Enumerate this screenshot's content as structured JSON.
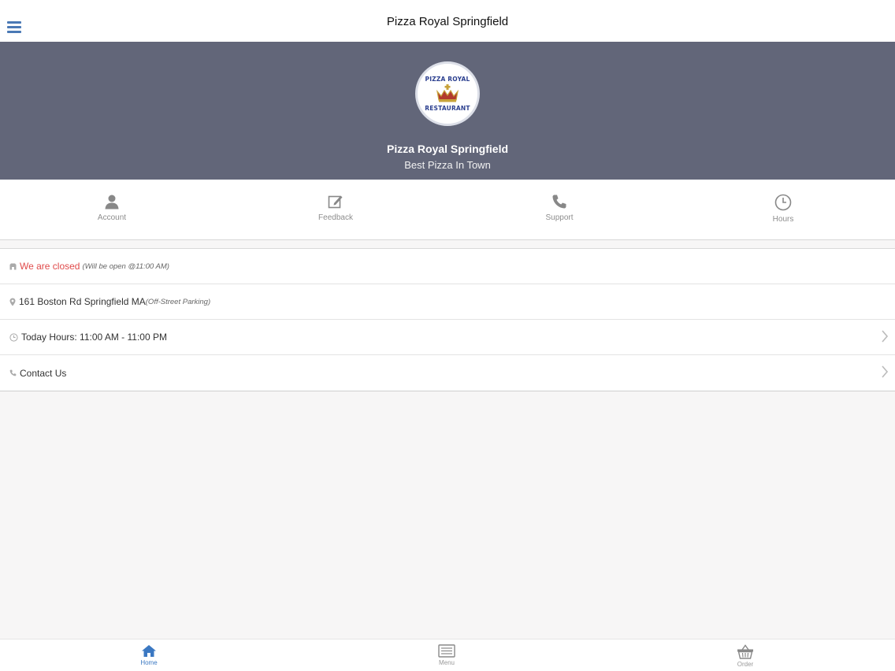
{
  "header": {
    "title": "Pizza Royal Springfield"
  },
  "hero": {
    "logo_line1": "PIZZA ROYAL",
    "logo_line2": "RESTAURANT",
    "name": "Pizza Royal Springfield",
    "tagline": "Best Pizza In Town"
  },
  "actions": [
    {
      "label": "Account",
      "icon": "person-icon"
    },
    {
      "label": "Feedback",
      "icon": "edit-icon"
    },
    {
      "label": "Support",
      "icon": "phone-icon"
    },
    {
      "label": "Hours",
      "icon": "clock-icon"
    }
  ],
  "info": {
    "status": "We are closed",
    "status_note": "(Will be open @11:00 AM)",
    "address": "161 Boston Rd Springfield MA",
    "address_note": "(Off-Street Parking)",
    "hours": "Today Hours: 11:00 AM - 11:00 PM",
    "contact": "Contact Us"
  },
  "tabs": [
    {
      "label": "Home",
      "icon": "home-icon",
      "active": true
    },
    {
      "label": "Menu",
      "icon": "menu-list-icon",
      "active": false
    },
    {
      "label": "Order",
      "icon": "basket-icon",
      "active": false
    }
  ],
  "colors": {
    "accent": "#4a79b5",
    "hero_bg": "#626679",
    "closed_text": "#e04a4a"
  }
}
